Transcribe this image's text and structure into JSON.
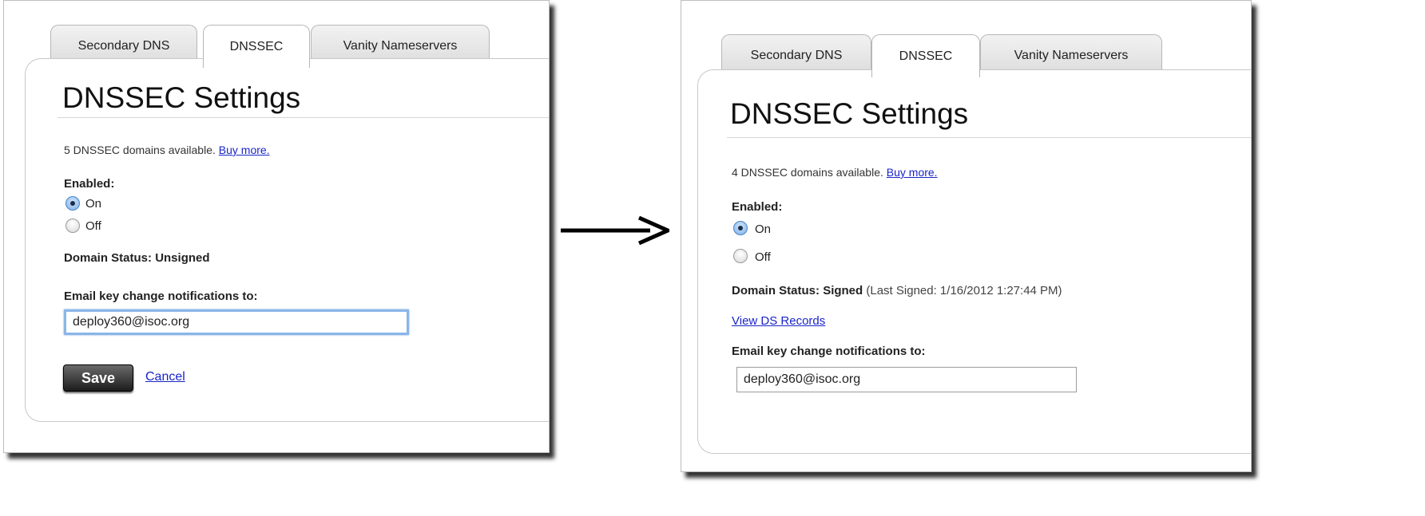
{
  "before": {
    "tabs": [
      "Secondary DNS",
      "DNSSEC",
      "Vanity Nameservers"
    ],
    "title": "DNSSEC Settings",
    "domains_available": "5 DNSSEC domains available.",
    "buy_more": "Buy more.",
    "enabled_label": "Enabled:",
    "radio_on": "On",
    "radio_off": "Off",
    "selected": "On",
    "status_label": "Domain Status:",
    "status_value": "Unsigned",
    "email_label": "Email key change notifications to:",
    "email_value": "deploy360@isoc.org",
    "save_label": "Save",
    "cancel_label": "Cancel"
  },
  "after": {
    "tabs": [
      "Secondary DNS",
      "DNSSEC",
      "Vanity Nameservers"
    ],
    "title": "DNSSEC Settings",
    "domains_available": "4 DNSSEC domains available.",
    "buy_more": "Buy more.",
    "enabled_label": "Enabled:",
    "radio_on": "On",
    "radio_off": "Off",
    "selected": "On",
    "status_label": "Domain Status:",
    "status_value": "Signed",
    "last_signed": "(Last Signed: 1/16/2012 1:27:44 PM)",
    "view_ds_records": "View DS Records",
    "email_label": "Email key change notifications to:",
    "email_value": "deploy360@isoc.org"
  },
  "colors": {
    "link": "#1a24c8",
    "focus_ring": "#8ab6e8",
    "save_button": "#2a2a2a",
    "radio_selected": "#7fb0e6"
  },
  "icons": {
    "arrow": "right-arrow-icon"
  }
}
